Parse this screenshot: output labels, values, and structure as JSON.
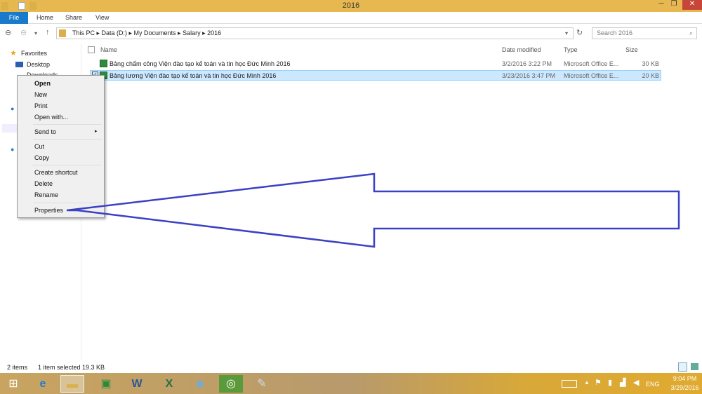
{
  "window": {
    "title": "2016",
    "min": "─",
    "max": "❐",
    "close": "✕"
  },
  "ribbon": {
    "tabs": [
      "File",
      "Home",
      "Share",
      "View"
    ]
  },
  "address": {
    "crumbs": "This PC  ▸  Data (D:)  ▸  My Documents  ▸  Salary  ▸  2016",
    "search_placeholder": "Search 2016"
  },
  "sidebar": {
    "items": [
      "Favorites",
      "Desktop",
      "Downloads"
    ]
  },
  "columns": [
    "Name",
    "Date modified",
    "Type",
    "Size"
  ],
  "files": [
    {
      "name": "Bảng chấm công Viện đào tạo kế toán và tin học Đức Minh 2016",
      "date": "3/2/2016 3:22 PM",
      "type": "Microsoft Office E...",
      "size": "30 KB"
    },
    {
      "name": "Bảng lương Viện đào tạo kế toán và tin học Đức Minh 2016",
      "date": "3/23/2016 3:47 PM",
      "type": "Microsoft Office E...",
      "size": "20 KB"
    }
  ],
  "context_menu": [
    "Open",
    "New",
    "Print",
    "Open with...",
    "Send to",
    "Cut",
    "Copy",
    "Create shortcut",
    "Delete",
    "Rename",
    "Properties"
  ],
  "status": {
    "items": "2 items",
    "selected": "1 item selected  19.3 KB"
  },
  "tray": {
    "lang": "ENG",
    "time": "9:04 PM",
    "date": "3/29/2016"
  },
  "arrow_color": "#3b40c4"
}
